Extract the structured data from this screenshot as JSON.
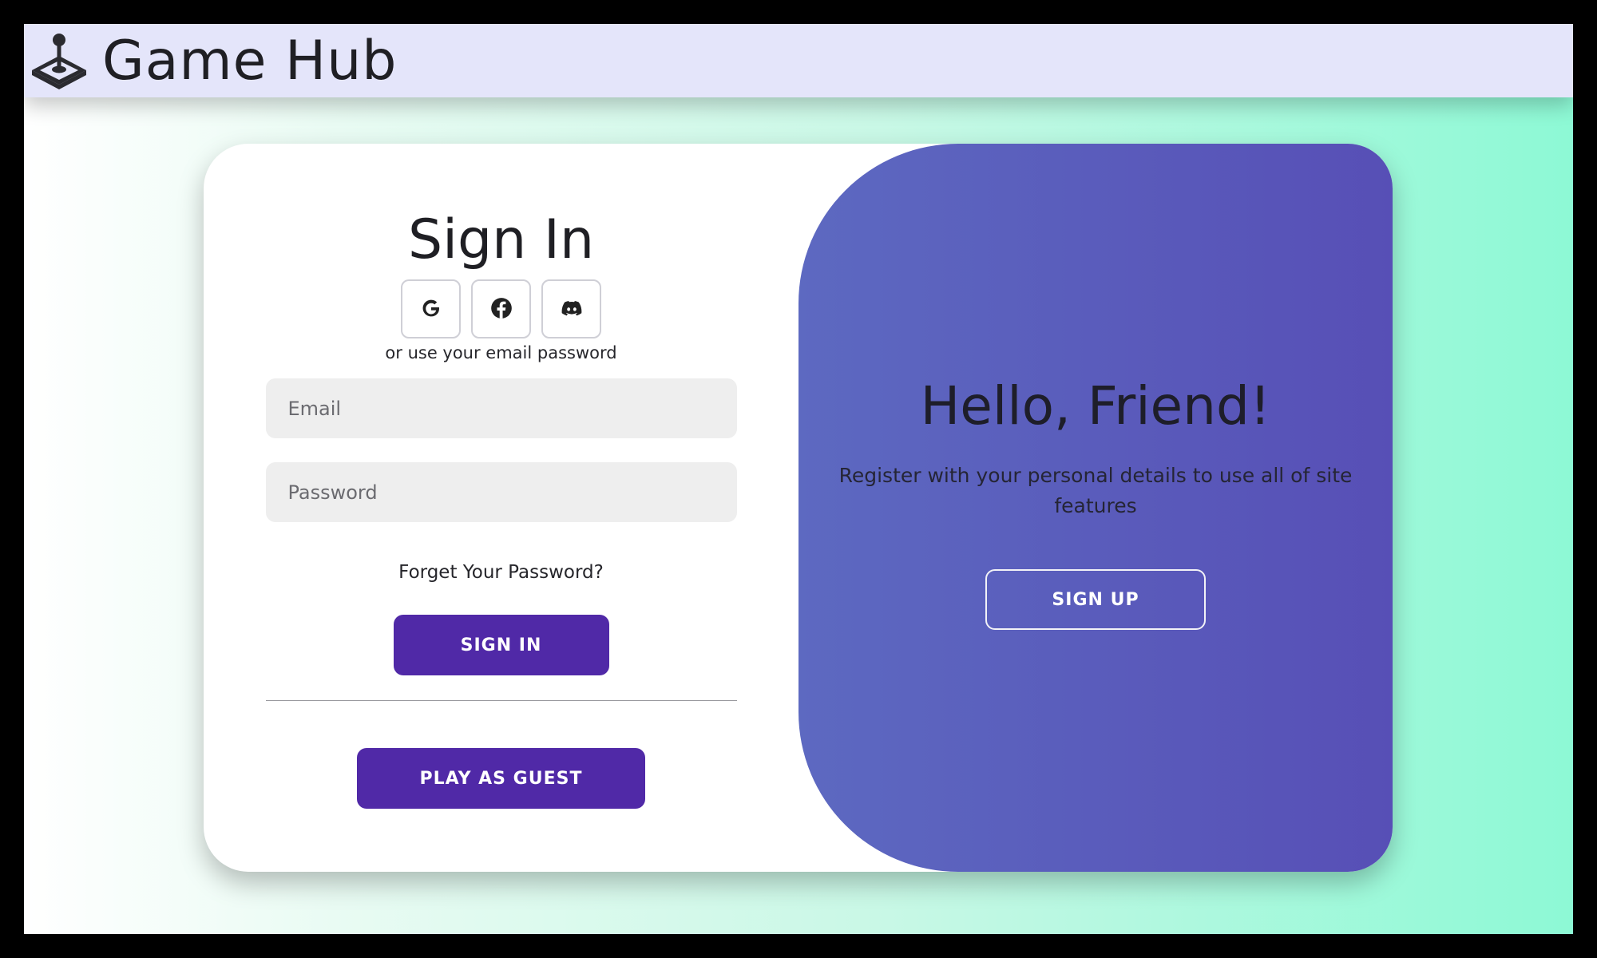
{
  "header": {
    "logo_icon": "joystick-icon",
    "title": "Game Hub"
  },
  "signin": {
    "title": "Sign In",
    "social": [
      {
        "icon": "google-icon"
      },
      {
        "icon": "facebook-icon"
      },
      {
        "icon": "discord-icon"
      }
    ],
    "alt_text": "or use your email password",
    "email_placeholder": "Email",
    "password_placeholder": "Password",
    "forgot": "Forget Your Password?",
    "signin_button": "SIGN IN",
    "guest_button": "PLAY AS GUEST"
  },
  "welcome": {
    "title": "Hello, Friend!",
    "text": "Register with your personal details to use all of site features",
    "signup_button": "SIGN UP"
  },
  "colors": {
    "primary_button": "#5029a7",
    "panel_gradient": [
      "#5d69c1",
      "#574fb6"
    ],
    "header_bg": "#e4e5fa",
    "page_gradient_end": "#8df9d5"
  }
}
